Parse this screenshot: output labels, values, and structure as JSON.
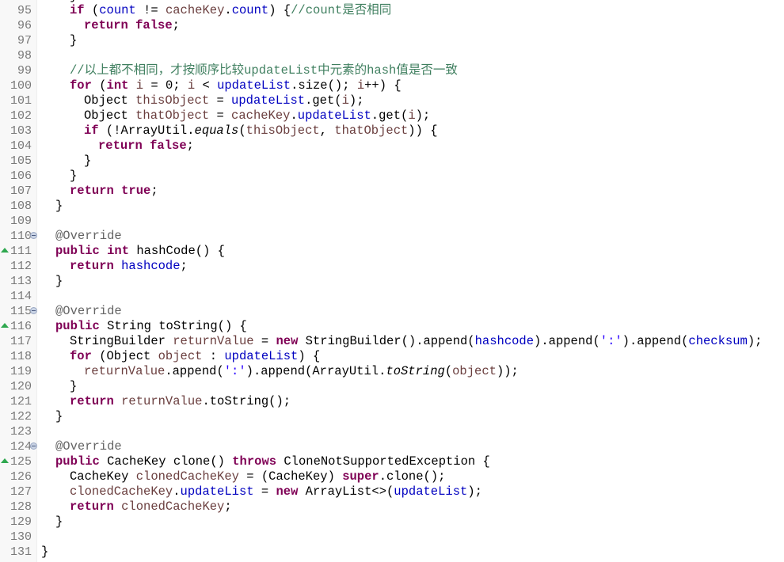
{
  "editor": {
    "language": "java",
    "first_visible_line": 95,
    "colors": {
      "keyword": "#7f0055",
      "field": "#0000c0",
      "local_variable": "#6a3e3e",
      "comment": "#3f7f5f",
      "char_literal": "#2a00ff",
      "annotation": "#646464",
      "line_number": "#787878",
      "override_marker": "#2fa84f"
    },
    "partial_top_line": "}",
    "lines": [
      {
        "num": "95",
        "indent": 2,
        "tokens": [
          [
            "kw",
            "if"
          ],
          [
            "p",
            " ("
          ],
          [
            "fld",
            "count"
          ],
          [
            "p",
            " != "
          ],
          [
            "loc",
            "cacheKey"
          ],
          [
            "p",
            "."
          ],
          [
            "fld",
            "count"
          ],
          [
            "p",
            ") {"
          ],
          [
            "cmt",
            "//count是否相同"
          ]
        ]
      },
      {
        "num": "96",
        "indent": 3,
        "tokens": [
          [
            "kw",
            "return"
          ],
          [
            "p",
            " "
          ],
          [
            "kw",
            "false"
          ],
          [
            "p",
            ";"
          ]
        ]
      },
      {
        "num": "97",
        "indent": 2,
        "tokens": [
          [
            "p",
            "}"
          ]
        ]
      },
      {
        "num": "98",
        "indent": 0,
        "tokens": []
      },
      {
        "num": "99",
        "indent": 2,
        "tokens": [
          [
            "cmt",
            "//以上都不相同，才按顺序比较updateList中元素的hash值是否一致"
          ]
        ]
      },
      {
        "num": "100",
        "indent": 2,
        "tokens": [
          [
            "kw",
            "for"
          ],
          [
            "p",
            " ("
          ],
          [
            "kw",
            "int"
          ],
          [
            "p",
            " "
          ],
          [
            "loc",
            "i"
          ],
          [
            "p",
            " = 0; "
          ],
          [
            "loc",
            "i"
          ],
          [
            "p",
            " < "
          ],
          [
            "fld",
            "updateList"
          ],
          [
            "p",
            ".size(); "
          ],
          [
            "loc",
            "i"
          ],
          [
            "p",
            "++) {"
          ]
        ]
      },
      {
        "num": "101",
        "indent": 3,
        "tokens": [
          [
            "p",
            "Object "
          ],
          [
            "loc",
            "thisObject"
          ],
          [
            "p",
            " = "
          ],
          [
            "fld",
            "updateList"
          ],
          [
            "p",
            ".get("
          ],
          [
            "loc",
            "i"
          ],
          [
            "p",
            ");"
          ]
        ]
      },
      {
        "num": "102",
        "indent": 3,
        "tokens": [
          [
            "p",
            "Object "
          ],
          [
            "loc",
            "thatObject"
          ],
          [
            "p",
            " = "
          ],
          [
            "loc",
            "cacheKey"
          ],
          [
            "p",
            "."
          ],
          [
            "fld",
            "updateList"
          ],
          [
            "p",
            ".get("
          ],
          [
            "loc",
            "i"
          ],
          [
            "p",
            ");"
          ]
        ]
      },
      {
        "num": "103",
        "indent": 3,
        "tokens": [
          [
            "kw",
            "if"
          ],
          [
            "p",
            " (!ArrayUtil."
          ],
          [
            "ital",
            "equals"
          ],
          [
            "p",
            "("
          ],
          [
            "loc",
            "thisObject"
          ],
          [
            "p",
            ", "
          ],
          [
            "loc",
            "thatObject"
          ],
          [
            "p",
            ")) {"
          ]
        ]
      },
      {
        "num": "104",
        "indent": 4,
        "tokens": [
          [
            "kw",
            "return"
          ],
          [
            "p",
            " "
          ],
          [
            "kw",
            "false"
          ],
          [
            "p",
            ";"
          ]
        ]
      },
      {
        "num": "105",
        "indent": 3,
        "tokens": [
          [
            "p",
            "}"
          ]
        ]
      },
      {
        "num": "106",
        "indent": 2,
        "tokens": [
          [
            "p",
            "}"
          ]
        ]
      },
      {
        "num": "107",
        "indent": 2,
        "tokens": [
          [
            "kw",
            "return"
          ],
          [
            "p",
            " "
          ],
          [
            "kw",
            "true"
          ],
          [
            "p",
            ";"
          ]
        ]
      },
      {
        "num": "108",
        "indent": 1,
        "tokens": [
          [
            "p",
            "}"
          ]
        ]
      },
      {
        "num": "109",
        "indent": 0,
        "tokens": []
      },
      {
        "num": "110",
        "indent": 1,
        "fold": true,
        "tokens": [
          [
            "ann",
            "@Override"
          ]
        ]
      },
      {
        "num": "111",
        "indent": 1,
        "override": true,
        "tokens": [
          [
            "kw",
            "public"
          ],
          [
            "p",
            " "
          ],
          [
            "kw",
            "int"
          ],
          [
            "p",
            " hashCode() {"
          ]
        ]
      },
      {
        "num": "112",
        "indent": 2,
        "tokens": [
          [
            "kw",
            "return"
          ],
          [
            "p",
            " "
          ],
          [
            "fld",
            "hashcode"
          ],
          [
            "p",
            ";"
          ]
        ]
      },
      {
        "num": "113",
        "indent": 1,
        "tokens": [
          [
            "p",
            "}"
          ]
        ]
      },
      {
        "num": "114",
        "indent": 0,
        "tokens": []
      },
      {
        "num": "115",
        "indent": 1,
        "fold": true,
        "tokens": [
          [
            "ann",
            "@Override"
          ]
        ]
      },
      {
        "num": "116",
        "indent": 1,
        "override": true,
        "tokens": [
          [
            "kw",
            "public"
          ],
          [
            "p",
            " String toString() {"
          ]
        ]
      },
      {
        "num": "117",
        "indent": 2,
        "tokens": [
          [
            "p",
            "StringBuilder "
          ],
          [
            "loc",
            "returnValue"
          ],
          [
            "p",
            " = "
          ],
          [
            "kw",
            "new"
          ],
          [
            "p",
            " StringBuilder().append("
          ],
          [
            "fld",
            "hashcode"
          ],
          [
            "p",
            ").append("
          ],
          [
            "str",
            "':'"
          ],
          [
            "p",
            ").append("
          ],
          [
            "fld",
            "checksum"
          ],
          [
            "p",
            ");"
          ]
        ]
      },
      {
        "num": "118",
        "indent": 2,
        "tokens": [
          [
            "kw",
            "for"
          ],
          [
            "p",
            " (Object "
          ],
          [
            "loc",
            "object"
          ],
          [
            "p",
            " : "
          ],
          [
            "fld",
            "updateList"
          ],
          [
            "p",
            ") {"
          ]
        ]
      },
      {
        "num": "119",
        "indent": 3,
        "tokens": [
          [
            "loc",
            "returnValue"
          ],
          [
            "p",
            ".append("
          ],
          [
            "str",
            "':'"
          ],
          [
            "p",
            ").append(ArrayUtil."
          ],
          [
            "ital",
            "toString"
          ],
          [
            "p",
            "("
          ],
          [
            "loc",
            "object"
          ],
          [
            "p",
            "));"
          ]
        ]
      },
      {
        "num": "120",
        "indent": 2,
        "tokens": [
          [
            "p",
            "}"
          ]
        ]
      },
      {
        "num": "121",
        "indent": 2,
        "tokens": [
          [
            "kw",
            "return"
          ],
          [
            "p",
            " "
          ],
          [
            "loc",
            "returnValue"
          ],
          [
            "p",
            ".toString();"
          ]
        ]
      },
      {
        "num": "122",
        "indent": 1,
        "tokens": [
          [
            "p",
            "}"
          ]
        ]
      },
      {
        "num": "123",
        "indent": 0,
        "tokens": []
      },
      {
        "num": "124",
        "indent": 1,
        "fold": true,
        "tokens": [
          [
            "ann",
            "@Override"
          ]
        ]
      },
      {
        "num": "125",
        "indent": 1,
        "override": true,
        "tokens": [
          [
            "kw",
            "public"
          ],
          [
            "p",
            " CacheKey clone() "
          ],
          [
            "kw",
            "throws"
          ],
          [
            "p",
            " CloneNotSupportedException {"
          ]
        ]
      },
      {
        "num": "126",
        "indent": 2,
        "tokens": [
          [
            "p",
            "CacheKey "
          ],
          [
            "loc",
            "clonedCacheKey"
          ],
          [
            "p",
            " = (CacheKey) "
          ],
          [
            "kw",
            "super"
          ],
          [
            "p",
            ".clone();"
          ]
        ]
      },
      {
        "num": "127",
        "indent": 2,
        "tokens": [
          [
            "loc",
            "clonedCacheKey"
          ],
          [
            "p",
            "."
          ],
          [
            "fld",
            "updateList"
          ],
          [
            "p",
            " = "
          ],
          [
            "kw",
            "new"
          ],
          [
            "p",
            " ArrayList<>("
          ],
          [
            "fld",
            "updateList"
          ],
          [
            "p",
            ");"
          ]
        ]
      },
      {
        "num": "128",
        "indent": 2,
        "tokens": [
          [
            "kw",
            "return"
          ],
          [
            "p",
            " "
          ],
          [
            "loc",
            "clonedCacheKey"
          ],
          [
            "p",
            ";"
          ]
        ]
      },
      {
        "num": "129",
        "indent": 1,
        "tokens": [
          [
            "p",
            "}"
          ]
        ]
      },
      {
        "num": "130",
        "indent": 0,
        "tokens": []
      },
      {
        "num": "131",
        "indent": 0,
        "tokens": [
          [
            "p",
            "}"
          ]
        ]
      }
    ]
  }
}
